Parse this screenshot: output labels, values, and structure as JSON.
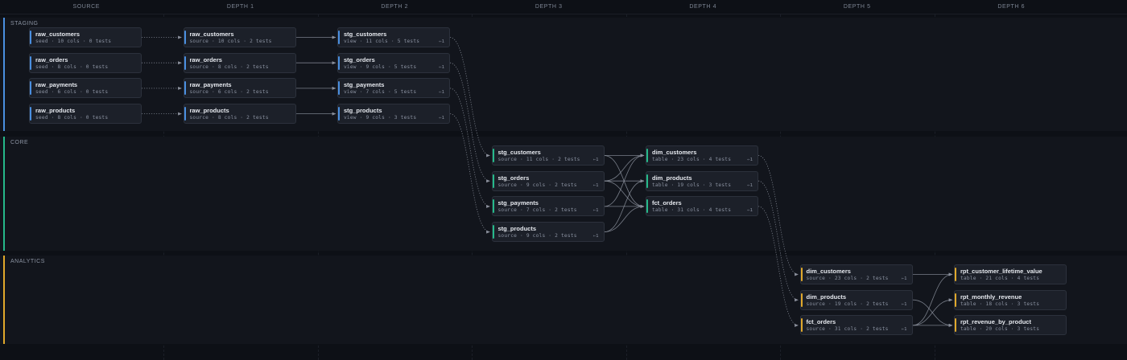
{
  "columns": [
    "SOURCE",
    "DEPTH 1",
    "DEPTH 2",
    "DEPTH 3",
    "DEPTH 4",
    "DEPTH 5",
    "DEPTH 6"
  ],
  "colors": {
    "staging": "#4a8fe0",
    "core": "#26b98a",
    "analytics": "#e0a82b",
    "edge": "#8b909c",
    "background": "#0d1016"
  },
  "lanes": [
    {
      "id": "staging",
      "label": "STAGING"
    },
    {
      "id": "core",
      "label": "CORE"
    },
    {
      "id": "analytics",
      "label": "ANALYTICS"
    }
  ],
  "nodes": [
    {
      "id": "s_raw_customers",
      "lane": "staging",
      "depth": 0,
      "row": 0,
      "name": "raw_customers",
      "meta": "seed · 10 cols · 0 tests",
      "badge": ""
    },
    {
      "id": "s_raw_orders",
      "lane": "staging",
      "depth": 0,
      "row": 1,
      "name": "raw_orders",
      "meta": "seed · 8 cols · 0 tests",
      "badge": ""
    },
    {
      "id": "s_raw_payments",
      "lane": "staging",
      "depth": 0,
      "row": 2,
      "name": "raw_payments",
      "meta": "seed · 6 cols · 0 tests",
      "badge": ""
    },
    {
      "id": "s_raw_products",
      "lane": "staging",
      "depth": 0,
      "row": 3,
      "name": "raw_products",
      "meta": "seed · 8 cols · 0 tests",
      "badge": ""
    },
    {
      "id": "d1_raw_customers",
      "lane": "staging",
      "depth": 1,
      "row": 0,
      "name": "raw_customers",
      "meta": "source · 10 cols · 2 tests",
      "badge": ""
    },
    {
      "id": "d1_raw_orders",
      "lane": "staging",
      "depth": 1,
      "row": 1,
      "name": "raw_orders",
      "meta": "source · 8 cols · 2 tests",
      "badge": ""
    },
    {
      "id": "d1_raw_payments",
      "lane": "staging",
      "depth": 1,
      "row": 2,
      "name": "raw_payments",
      "meta": "source · 6 cols · 2 tests",
      "badge": ""
    },
    {
      "id": "d1_raw_products",
      "lane": "staging",
      "depth": 1,
      "row": 3,
      "name": "raw_products",
      "meta": "source · 8 cols · 2 tests",
      "badge": ""
    },
    {
      "id": "d2_stg_customers",
      "lane": "staging",
      "depth": 2,
      "row": 0,
      "name": "stg_customers",
      "meta": "view · 11 cols · 5 tests",
      "badge": "⇐1"
    },
    {
      "id": "d2_stg_orders",
      "lane": "staging",
      "depth": 2,
      "row": 1,
      "name": "stg_orders",
      "meta": "view · 9 cols · 5 tests",
      "badge": "⇐1"
    },
    {
      "id": "d2_stg_payments",
      "lane": "staging",
      "depth": 2,
      "row": 2,
      "name": "stg_payments",
      "meta": "view · 7 cols · 5 tests",
      "badge": "⇐1"
    },
    {
      "id": "d2_stg_products",
      "lane": "staging",
      "depth": 2,
      "row": 3,
      "name": "stg_products",
      "meta": "view · 9 cols · 3 tests",
      "badge": "⇐1"
    },
    {
      "id": "d3_stg_customers",
      "lane": "core",
      "depth": 3,
      "row": 0,
      "name": "stg_customers",
      "meta": "source · 11 cols · 2 tests",
      "badge": "⇐1"
    },
    {
      "id": "d3_stg_orders",
      "lane": "core",
      "depth": 3,
      "row": 1,
      "name": "stg_orders",
      "meta": "source · 9 cols · 2 tests",
      "badge": "⇐1"
    },
    {
      "id": "d3_stg_payments",
      "lane": "core",
      "depth": 3,
      "row": 2,
      "name": "stg_payments",
      "meta": "source · 7 cols · 2 tests",
      "badge": "⇐1"
    },
    {
      "id": "d3_stg_products",
      "lane": "core",
      "depth": 3,
      "row": 3,
      "name": "stg_products",
      "meta": "source · 9 cols · 2 tests",
      "badge": "⇐1"
    },
    {
      "id": "d4_dim_customers",
      "lane": "core",
      "depth": 4,
      "row": 0,
      "name": "dim_customers",
      "meta": "table · 23 cols · 4 tests",
      "badge": "⇐1"
    },
    {
      "id": "d4_dim_products",
      "lane": "core",
      "depth": 4,
      "row": 1,
      "name": "dim_products",
      "meta": "table · 19 cols · 3 tests",
      "badge": "⇐1"
    },
    {
      "id": "d4_fct_orders",
      "lane": "core",
      "depth": 4,
      "row": 2,
      "name": "fct_orders",
      "meta": "table · 31 cols · 4 tests",
      "badge": "⇐1"
    },
    {
      "id": "d5_dim_customers",
      "lane": "analytics",
      "depth": 5,
      "row": 0,
      "name": "dim_customers",
      "meta": "source · 23 cols · 2 tests",
      "badge": "⇐1"
    },
    {
      "id": "d5_dim_products",
      "lane": "analytics",
      "depth": 5,
      "row": 1,
      "name": "dim_products",
      "meta": "source · 19 cols · 2 tests",
      "badge": "⇐1"
    },
    {
      "id": "d5_fct_orders",
      "lane": "analytics",
      "depth": 5,
      "row": 2,
      "name": "fct_orders",
      "meta": "source · 31 cols · 2 tests",
      "badge": "⇐1"
    },
    {
      "id": "d6_rpt_clv",
      "lane": "analytics",
      "depth": 6,
      "row": 0,
      "name": "rpt_customer_lifetime_value",
      "meta": "table · 21 cols · 4 tests",
      "badge": ""
    },
    {
      "id": "d6_rpt_monthly",
      "lane": "analytics",
      "depth": 6,
      "row": 1,
      "name": "rpt_monthly_revenue",
      "meta": "table · 18 cols · 3 tests",
      "badge": ""
    },
    {
      "id": "d6_rpt_rev_product",
      "lane": "analytics",
      "depth": 6,
      "row": 2,
      "name": "rpt_revenue_by_product",
      "meta": "table · 20 cols · 3 tests",
      "badge": ""
    }
  ],
  "edges": [
    {
      "from": "s_raw_customers",
      "to": "d1_raw_customers",
      "style": "dotted"
    },
    {
      "from": "s_raw_orders",
      "to": "d1_raw_orders",
      "style": "dotted"
    },
    {
      "from": "s_raw_payments",
      "to": "d1_raw_payments",
      "style": "dotted"
    },
    {
      "from": "s_raw_products",
      "to": "d1_raw_products",
      "style": "dotted"
    },
    {
      "from": "d1_raw_customers",
      "to": "d2_stg_customers",
      "style": "solid"
    },
    {
      "from": "d1_raw_orders",
      "to": "d2_stg_orders",
      "style": "solid"
    },
    {
      "from": "d1_raw_payments",
      "to": "d2_stg_payments",
      "style": "solid"
    },
    {
      "from": "d1_raw_products",
      "to": "d2_stg_products",
      "style": "solid"
    },
    {
      "from": "d2_stg_customers",
      "to": "d3_stg_customers",
      "style": "dotted"
    },
    {
      "from": "d2_stg_orders",
      "to": "d3_stg_orders",
      "style": "dotted"
    },
    {
      "from": "d2_stg_payments",
      "to": "d3_stg_payments",
      "style": "dotted"
    },
    {
      "from": "d2_stg_products",
      "to": "d3_stg_products",
      "style": "dotted"
    },
    {
      "from": "d3_stg_customers",
      "to": "d4_dim_customers",
      "style": "solid"
    },
    {
      "from": "d3_stg_orders",
      "to": "d4_dim_customers",
      "style": "solid"
    },
    {
      "from": "d3_stg_payments",
      "to": "d4_dim_customers",
      "style": "solid"
    },
    {
      "from": "d3_stg_orders",
      "to": "d4_dim_products",
      "style": "solid"
    },
    {
      "from": "d3_stg_products",
      "to": "d4_dim_products",
      "style": "solid"
    },
    {
      "from": "d3_stg_customers",
      "to": "d4_fct_orders",
      "style": "solid"
    },
    {
      "from": "d3_stg_orders",
      "to": "d4_fct_orders",
      "style": "solid"
    },
    {
      "from": "d3_stg_payments",
      "to": "d4_fct_orders",
      "style": "solid"
    },
    {
      "from": "d3_stg_products",
      "to": "d4_fct_orders",
      "style": "solid"
    },
    {
      "from": "d4_dim_customers",
      "to": "d5_dim_customers",
      "style": "dotted"
    },
    {
      "from": "d4_dim_products",
      "to": "d5_dim_products",
      "style": "dotted"
    },
    {
      "from": "d4_fct_orders",
      "to": "d5_fct_orders",
      "style": "dotted"
    },
    {
      "from": "d5_dim_customers",
      "to": "d6_rpt_clv",
      "style": "solid"
    },
    {
      "from": "d5_fct_orders",
      "to": "d6_rpt_clv",
      "style": "solid"
    },
    {
      "from": "d5_fct_orders",
      "to": "d6_rpt_monthly",
      "style": "solid"
    },
    {
      "from": "d5_dim_products",
      "to": "d6_rpt_rev_product",
      "style": "solid"
    },
    {
      "from": "d5_fct_orders",
      "to": "d6_rpt_rev_product",
      "style": "solid"
    }
  ]
}
